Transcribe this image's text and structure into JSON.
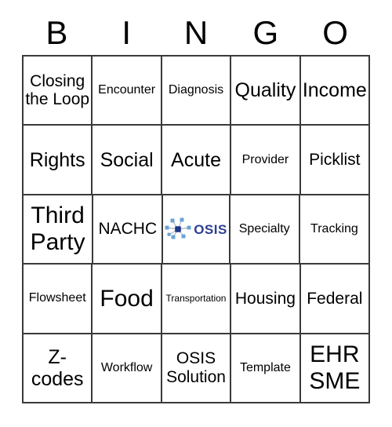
{
  "card": {
    "title": "BINGO Card",
    "header_letters": [
      "B",
      "I",
      "N",
      "G",
      "O"
    ],
    "colors": {
      "background": "#ffffff",
      "grid_line": "#3a3a3a",
      "text": "#000000",
      "logo_wordmark": "#2b3f91",
      "logo_center_node": "#1f3787",
      "logo_satellite_node": "#6ba3d6",
      "logo_spoke": "#9aa3ad"
    },
    "rows": [
      [
        {
          "text": "Closing the Loop",
          "size": "fs-md"
        },
        {
          "text": "Encounter",
          "size": "fs-sm"
        },
        {
          "text": "Diagnosis",
          "size": "fs-sm"
        },
        {
          "text": "Quality",
          "size": "fs-lg"
        },
        {
          "text": "Income",
          "size": "fs-lg"
        }
      ],
      [
        {
          "text": "Rights",
          "size": "fs-lg"
        },
        {
          "text": "Social",
          "size": "fs-lg"
        },
        {
          "text": "Acute",
          "size": "fs-lg"
        },
        {
          "text": "Provider",
          "size": "fs-sm"
        },
        {
          "text": "Picklist",
          "size": "fs-md"
        }
      ],
      [
        {
          "text": "Third Party",
          "size": "fs-xl"
        },
        {
          "text": "NACHC",
          "size": "fs-md"
        },
        {
          "text": "OSIS",
          "size": "logo"
        },
        {
          "text": "Specialty",
          "size": "fs-sm"
        },
        {
          "text": "Tracking",
          "size": "fs-sm"
        }
      ],
      [
        {
          "text": "Flowsheet",
          "size": "fs-sm"
        },
        {
          "text": "Food",
          "size": "fs-xl"
        },
        {
          "text": "Transportation",
          "size": "fs-xs"
        },
        {
          "text": "Housing",
          "size": "fs-md"
        },
        {
          "text": "Federal",
          "size": "fs-md"
        }
      ],
      [
        {
          "text": "Z-codes",
          "size": "fs-lg"
        },
        {
          "text": "Workflow",
          "size": "fs-sm"
        },
        {
          "text": "OSIS Solution",
          "size": "fs-md"
        },
        {
          "text": "Template",
          "size": "fs-sm"
        },
        {
          "text": "EHR SME",
          "size": "fs-xl"
        }
      ]
    ],
    "free_space": {
      "logo_name": "osis-logo",
      "wordmark": "OSIS",
      "mark_icon": "network-node-starburst-icon"
    }
  }
}
